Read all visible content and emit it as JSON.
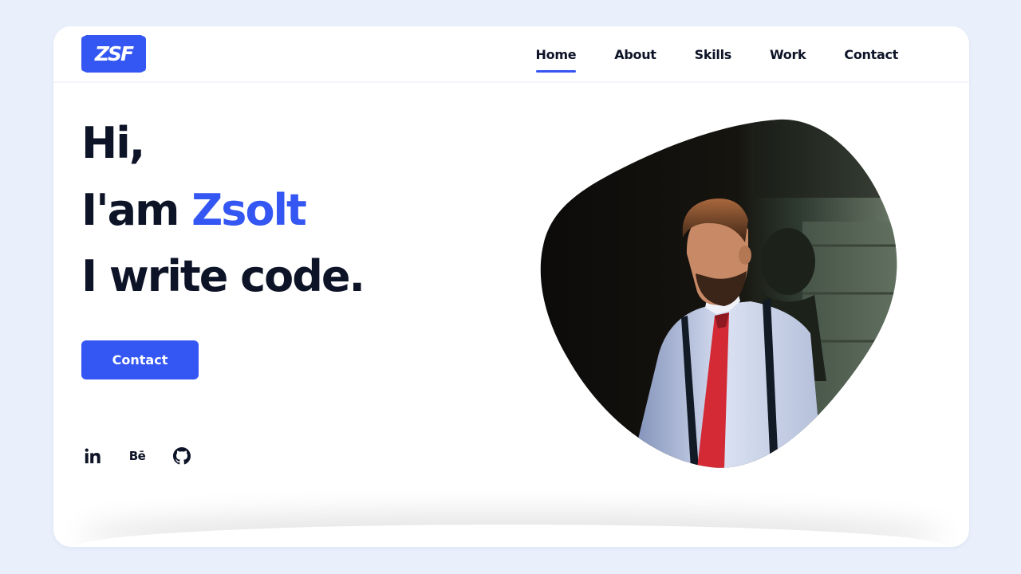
{
  "brand": {
    "logo_text": "ZSF",
    "accent_color": "#3456f2"
  },
  "nav": {
    "items": [
      {
        "label": "Home",
        "active": true
      },
      {
        "label": "About",
        "active": false
      },
      {
        "label": "Skills",
        "active": false
      },
      {
        "label": "Work",
        "active": false
      },
      {
        "label": "Contact",
        "active": false
      }
    ]
  },
  "hero": {
    "line1": "Hi,",
    "line2_prefix": "I'am ",
    "line2_name": "Zsolt",
    "line3": "I write code.",
    "cta_label": "Contact"
  },
  "socials": [
    {
      "icon": "linkedin-icon",
      "glyph": "in"
    },
    {
      "icon": "behance-icon",
      "glyph": "Bē"
    },
    {
      "icon": "github-icon",
      "glyph": ""
    }
  ],
  "colors": {
    "background": "#e9effb",
    "card": "#ffffff",
    "text": "#0e1428",
    "accent": "#3456f2"
  }
}
